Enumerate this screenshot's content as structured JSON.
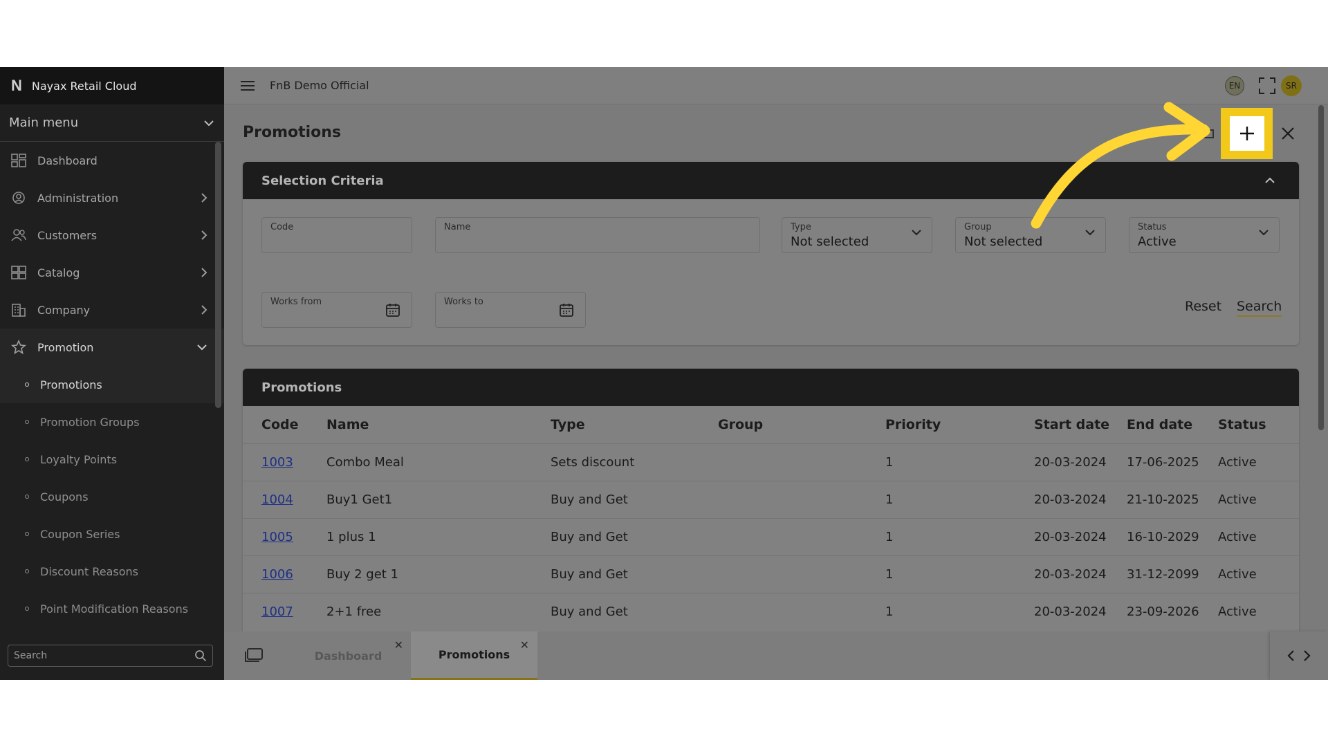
{
  "sidebar": {
    "brand_logo": "N",
    "brand": "Nayax Retail Cloud",
    "main_menu": "Main menu",
    "items": [
      {
        "label": "Dashboard"
      },
      {
        "label": "Administration"
      },
      {
        "label": "Customers"
      },
      {
        "label": "Catalog"
      },
      {
        "label": "Company"
      },
      {
        "label": "Promotion"
      }
    ],
    "subitems": [
      {
        "label": "Promotions"
      },
      {
        "label": "Promotion Groups"
      },
      {
        "label": "Loyalty Points"
      },
      {
        "label": "Coupons"
      },
      {
        "label": "Coupon Series"
      },
      {
        "label": "Discount Reasons"
      },
      {
        "label": "Point Modification Reasons"
      }
    ],
    "search_placeholder": "Search"
  },
  "topbar": {
    "company": "FnB Demo Official",
    "lang": "EN",
    "avatar": "SR"
  },
  "page": {
    "title": "Promotions"
  },
  "criteria": {
    "title": "Selection Criteria",
    "code_label": "Code",
    "name_label": "Name",
    "type_label": "Type",
    "type_value": "Not selected",
    "group_label": "Group",
    "group_value": "Not selected",
    "status_label": "Status",
    "status_value": "Active",
    "works_from_label": "Works from",
    "works_to_label": "Works to",
    "reset": "Reset",
    "search": "Search"
  },
  "table": {
    "title": "Promotions",
    "columns": [
      "Code",
      "Name",
      "Type",
      "Group",
      "Priority",
      "Start date",
      "End date",
      "Status"
    ],
    "rows": [
      [
        "1003",
        "Combo Meal",
        "Sets discount",
        "",
        "1",
        "20-03-2024",
        "17-06-2025",
        "Active"
      ],
      [
        "1004",
        "Buy1 Get1",
        "Buy and Get",
        "",
        "1",
        "20-03-2024",
        "21-10-2025",
        "Active"
      ],
      [
        "1005",
        "1 plus 1",
        "Buy and Get",
        "",
        "1",
        "20-03-2024",
        "16-10-2029",
        "Active"
      ],
      [
        "1006",
        "Buy 2 get 1",
        "Buy and Get",
        "",
        "1",
        "20-03-2024",
        "31-12-2099",
        "Active"
      ],
      [
        "1007",
        "2+1 free",
        "Buy and Get",
        "",
        "1",
        "20-03-2024",
        "23-09-2026",
        "Active"
      ]
    ]
  },
  "tabs": [
    {
      "label": "Dashboard"
    },
    {
      "label": "Promotions"
    }
  ],
  "colors": {
    "highlight": "#f2c81a",
    "arrow": "#ffd633"
  }
}
